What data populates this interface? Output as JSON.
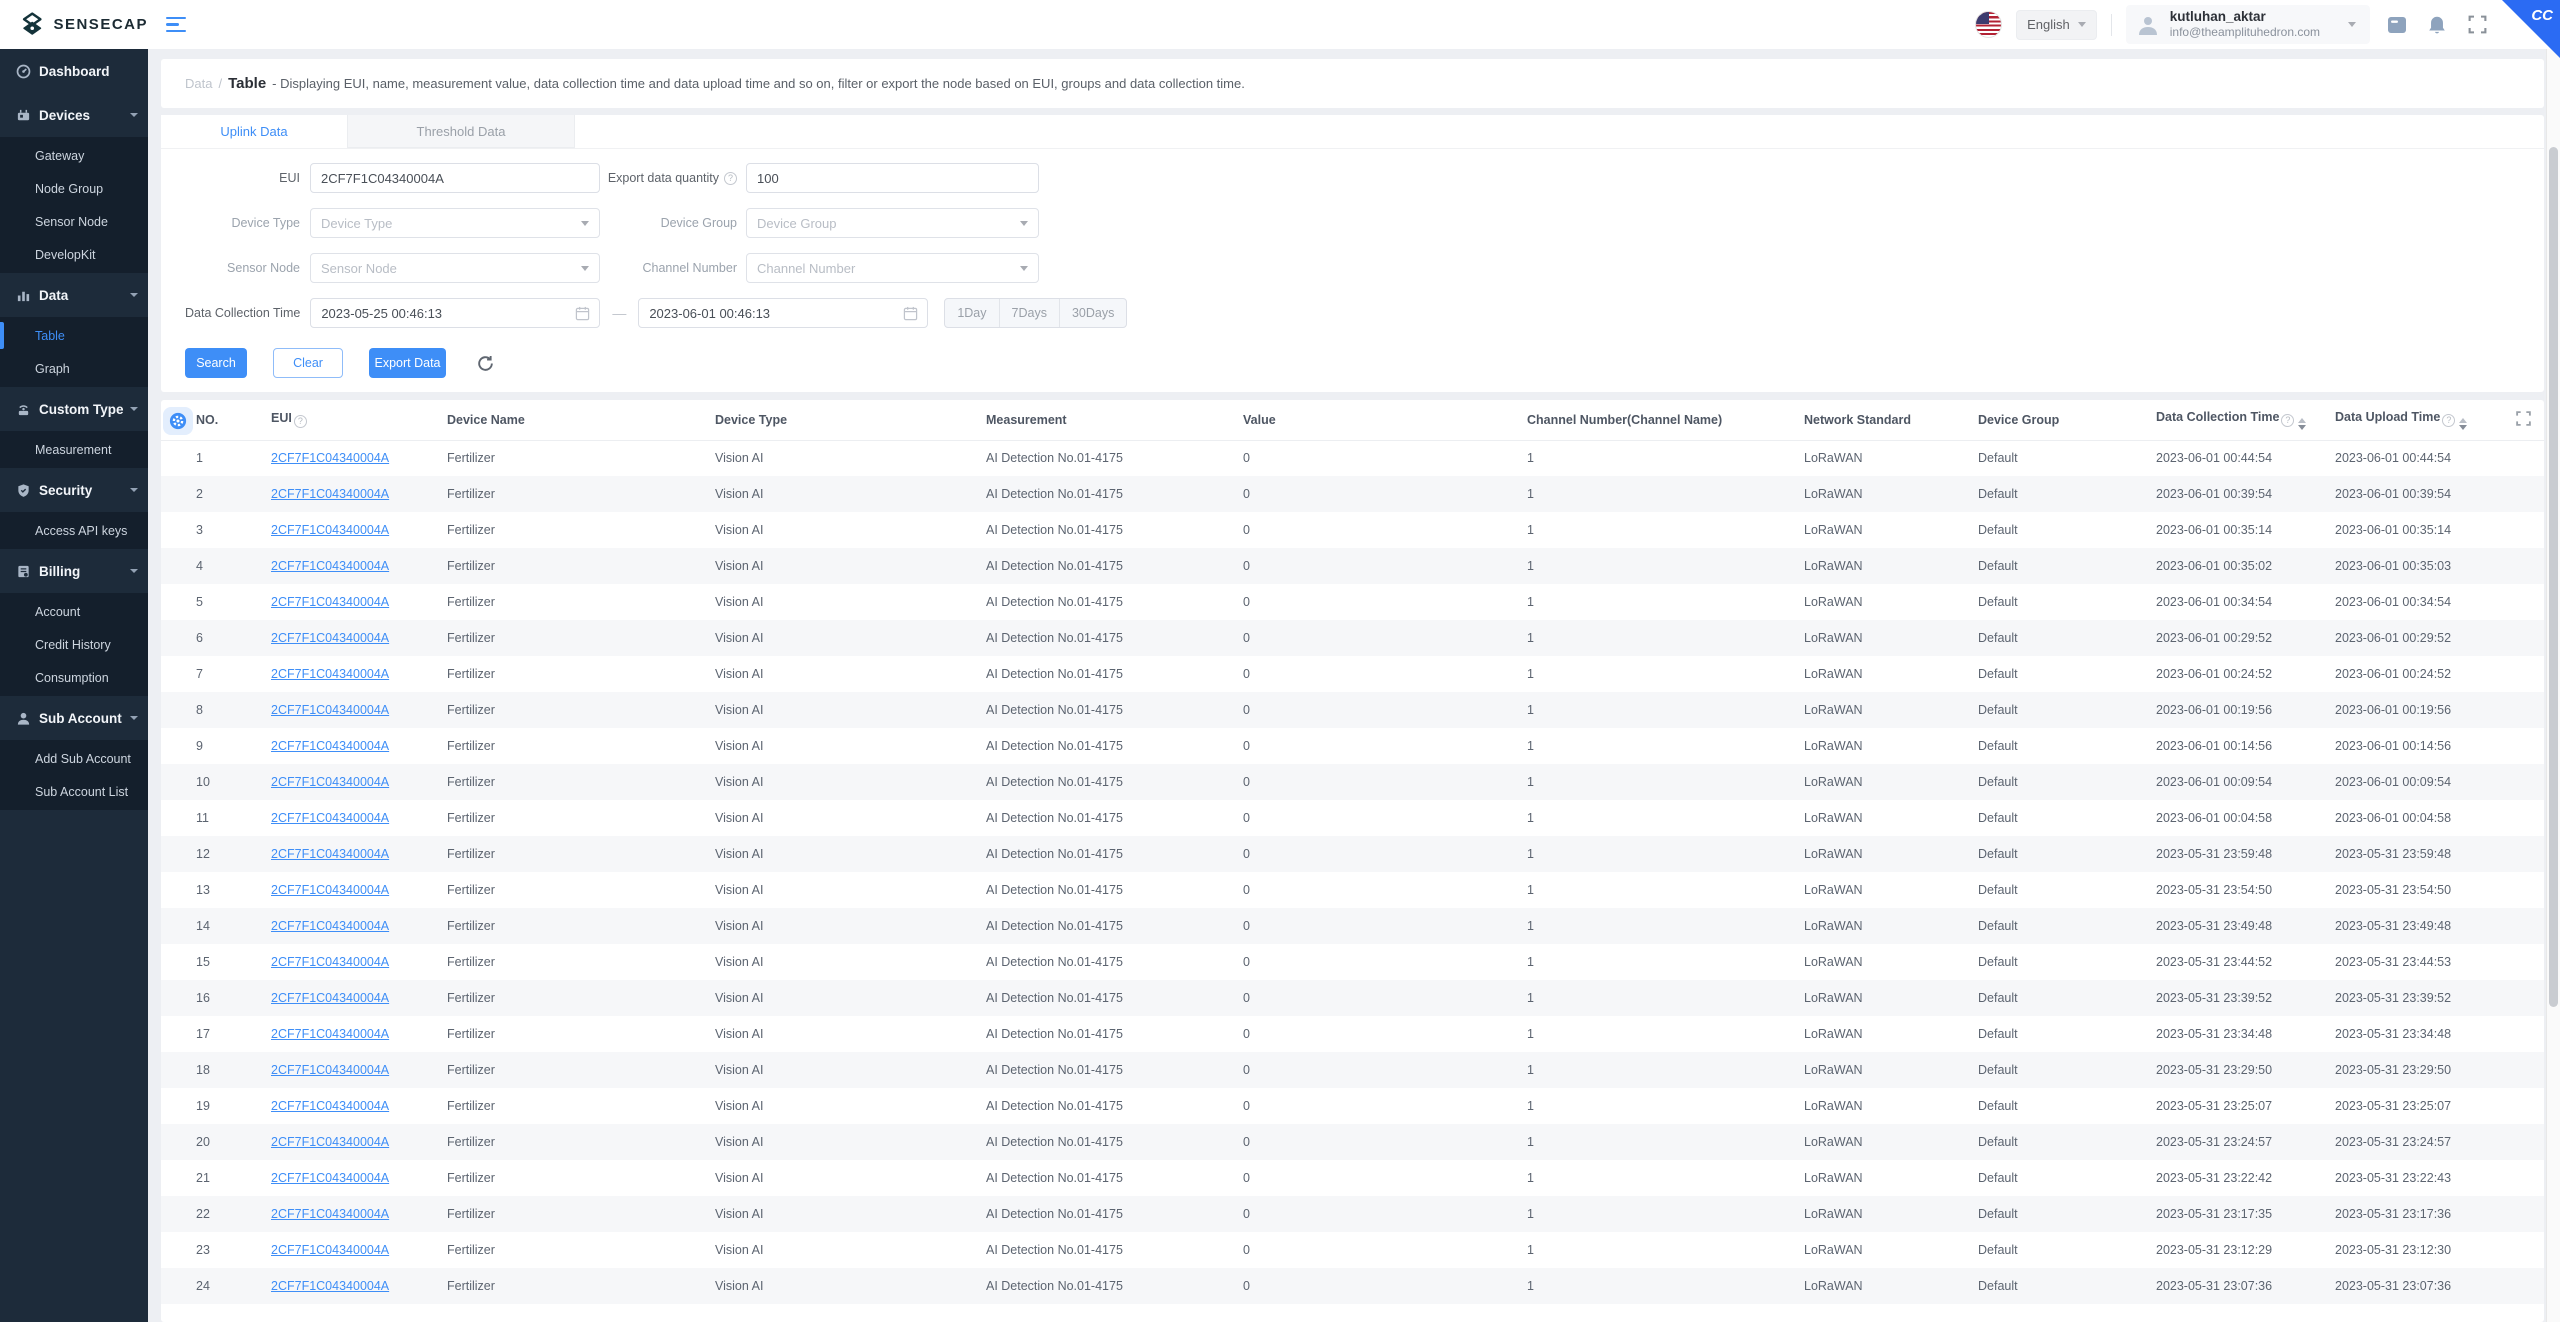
{
  "topbar": {
    "brand": "SENSECAP",
    "language": "English",
    "user_name": "kutluhan_aktar",
    "user_email": "info@theamplituhedron.com",
    "ribbon": "CC"
  },
  "sidebar": {
    "sections": [
      {
        "label": "Dashboard",
        "icon": "dashboard-icon",
        "expandable": false,
        "children": []
      },
      {
        "label": "Devices",
        "icon": "devices-icon",
        "expandable": true,
        "children": [
          {
            "label": "Gateway",
            "active": false
          },
          {
            "label": "Node Group",
            "active": false
          },
          {
            "label": "Sensor Node",
            "active": false
          },
          {
            "label": "DevelopKit",
            "active": false
          }
        ]
      },
      {
        "label": "Data",
        "icon": "data-icon",
        "expandable": true,
        "children": [
          {
            "label": "Table",
            "active": true
          },
          {
            "label": "Graph",
            "active": false
          }
        ]
      },
      {
        "label": "Custom Type",
        "icon": "custom-type-icon",
        "expandable": true,
        "children": [
          {
            "label": "Measurement",
            "active": false
          }
        ]
      },
      {
        "label": "Security",
        "icon": "security-icon",
        "expandable": true,
        "children": [
          {
            "label": "Access API keys",
            "active": false
          }
        ]
      },
      {
        "label": "Billing",
        "icon": "billing-icon",
        "expandable": true,
        "children": [
          {
            "label": "Account",
            "active": false
          },
          {
            "label": "Credit History",
            "active": false
          },
          {
            "label": "Consumption",
            "active": false
          }
        ]
      },
      {
        "label": "Sub Account",
        "icon": "sub-account-icon",
        "expandable": true,
        "children": [
          {
            "label": "Add Sub Account",
            "active": false
          },
          {
            "label": "Sub Account List",
            "active": false
          }
        ]
      }
    ]
  },
  "breadcrumb": {
    "section": "Data",
    "separator": "/",
    "page": "Table",
    "description": "- Displaying EUI, name, measurement value, data collection time and data upload time and so on, filter or export the node based on EUI, groups and data collection time."
  },
  "filter": {
    "tabs": {
      "uplink": "Uplink Data",
      "threshold": "Threshold Data"
    },
    "eui_label": "EUI",
    "eui_value": "2CF7F1C04340004A",
    "export_label": "Export data quantity",
    "export_value": "100",
    "device_type_label": "Device Type",
    "device_type_placeholder": "Device Type",
    "device_group_label": "Device Group",
    "device_group_placeholder": "Device Group",
    "sensor_node_label": "Sensor Node",
    "sensor_node_placeholder": "Sensor Node",
    "channel_number_label": "Channel Number",
    "channel_number_placeholder": "Channel Number",
    "date_label": "Data Collection Time",
    "date_from": "2023-05-25 00:46:13",
    "date_to": "2023-06-01 00:46:13",
    "quick_ranges": [
      "1Day",
      "7Days",
      "30Days"
    ],
    "search_label": "Search",
    "clear_label": "Clear",
    "export_btn_label": "Export Data"
  },
  "table": {
    "columns": [
      "NO.",
      "EUI",
      "Device Name",
      "Device Type",
      "Measurement",
      "Value",
      "Channel Number(Channel Name)",
      "Network Standard",
      "Device Group",
      "Data Collection Time",
      "Data Upload Time"
    ],
    "rows": [
      {
        "no": "1",
        "eui": "2CF7F1C04340004A",
        "device_name": "Fertilizer",
        "device_type": "Vision AI",
        "measurement": "AI Detection No.01-4175",
        "value": "0",
        "channel": "1",
        "network_standard": "LoRaWAN",
        "device_group": "Default",
        "collection_time": "2023-06-01 00:44:54",
        "upload_time": "2023-06-01 00:44:54"
      },
      {
        "no": "2",
        "eui": "2CF7F1C04340004A",
        "device_name": "Fertilizer",
        "device_type": "Vision AI",
        "measurement": "AI Detection No.01-4175",
        "value": "0",
        "channel": "1",
        "network_standard": "LoRaWAN",
        "device_group": "Default",
        "collection_time": "2023-06-01 00:39:54",
        "upload_time": "2023-06-01 00:39:54"
      },
      {
        "no": "3",
        "eui": "2CF7F1C04340004A",
        "device_name": "Fertilizer",
        "device_type": "Vision AI",
        "measurement": "AI Detection No.01-4175",
        "value": "0",
        "channel": "1",
        "network_standard": "LoRaWAN",
        "device_group": "Default",
        "collection_time": "2023-06-01 00:35:14",
        "upload_time": "2023-06-01 00:35:14"
      },
      {
        "no": "4",
        "eui": "2CF7F1C04340004A",
        "device_name": "Fertilizer",
        "device_type": "Vision AI",
        "measurement": "AI Detection No.01-4175",
        "value": "0",
        "channel": "1",
        "network_standard": "LoRaWAN",
        "device_group": "Default",
        "collection_time": "2023-06-01 00:35:02",
        "upload_time": "2023-06-01 00:35:03"
      },
      {
        "no": "5",
        "eui": "2CF7F1C04340004A",
        "device_name": "Fertilizer",
        "device_type": "Vision AI",
        "measurement": "AI Detection No.01-4175",
        "value": "0",
        "channel": "1",
        "network_standard": "LoRaWAN",
        "device_group": "Default",
        "collection_time": "2023-06-01 00:34:54",
        "upload_time": "2023-06-01 00:34:54"
      },
      {
        "no": "6",
        "eui": "2CF7F1C04340004A",
        "device_name": "Fertilizer",
        "device_type": "Vision AI",
        "measurement": "AI Detection No.01-4175",
        "value": "0",
        "channel": "1",
        "network_standard": "LoRaWAN",
        "device_group": "Default",
        "collection_time": "2023-06-01 00:29:52",
        "upload_time": "2023-06-01 00:29:52"
      },
      {
        "no": "7",
        "eui": "2CF7F1C04340004A",
        "device_name": "Fertilizer",
        "device_type": "Vision AI",
        "measurement": "AI Detection No.01-4175",
        "value": "0",
        "channel": "1",
        "network_standard": "LoRaWAN",
        "device_group": "Default",
        "collection_time": "2023-06-01 00:24:52",
        "upload_time": "2023-06-01 00:24:52"
      },
      {
        "no": "8",
        "eui": "2CF7F1C04340004A",
        "device_name": "Fertilizer",
        "device_type": "Vision AI",
        "measurement": "AI Detection No.01-4175",
        "value": "0",
        "channel": "1",
        "network_standard": "LoRaWAN",
        "device_group": "Default",
        "collection_time": "2023-06-01 00:19:56",
        "upload_time": "2023-06-01 00:19:56"
      },
      {
        "no": "9",
        "eui": "2CF7F1C04340004A",
        "device_name": "Fertilizer",
        "device_type": "Vision AI",
        "measurement": "AI Detection No.01-4175",
        "value": "0",
        "channel": "1",
        "network_standard": "LoRaWAN",
        "device_group": "Default",
        "collection_time": "2023-06-01 00:14:56",
        "upload_time": "2023-06-01 00:14:56"
      },
      {
        "no": "10",
        "eui": "2CF7F1C04340004A",
        "device_name": "Fertilizer",
        "device_type": "Vision AI",
        "measurement": "AI Detection No.01-4175",
        "value": "0",
        "channel": "1",
        "network_standard": "LoRaWAN",
        "device_group": "Default",
        "collection_time": "2023-06-01 00:09:54",
        "upload_time": "2023-06-01 00:09:54"
      },
      {
        "no": "11",
        "eui": "2CF7F1C04340004A",
        "device_name": "Fertilizer",
        "device_type": "Vision AI",
        "measurement": "AI Detection No.01-4175",
        "value": "0",
        "channel": "1",
        "network_standard": "LoRaWAN",
        "device_group": "Default",
        "collection_time": "2023-06-01 00:04:58",
        "upload_time": "2023-06-01 00:04:58"
      },
      {
        "no": "12",
        "eui": "2CF7F1C04340004A",
        "device_name": "Fertilizer",
        "device_type": "Vision AI",
        "measurement": "AI Detection No.01-4175",
        "value": "0",
        "channel": "1",
        "network_standard": "LoRaWAN",
        "device_group": "Default",
        "collection_time": "2023-05-31 23:59:48",
        "upload_time": "2023-05-31 23:59:48"
      },
      {
        "no": "13",
        "eui": "2CF7F1C04340004A",
        "device_name": "Fertilizer",
        "device_type": "Vision AI",
        "measurement": "AI Detection No.01-4175",
        "value": "0",
        "channel": "1",
        "network_standard": "LoRaWAN",
        "device_group": "Default",
        "collection_time": "2023-05-31 23:54:50",
        "upload_time": "2023-05-31 23:54:50"
      },
      {
        "no": "14",
        "eui": "2CF7F1C04340004A",
        "device_name": "Fertilizer",
        "device_type": "Vision AI",
        "measurement": "AI Detection No.01-4175",
        "value": "0",
        "channel": "1",
        "network_standard": "LoRaWAN",
        "device_group": "Default",
        "collection_time": "2023-05-31 23:49:48",
        "upload_time": "2023-05-31 23:49:48"
      },
      {
        "no": "15",
        "eui": "2CF7F1C04340004A",
        "device_name": "Fertilizer",
        "device_type": "Vision AI",
        "measurement": "AI Detection No.01-4175",
        "value": "0",
        "channel": "1",
        "network_standard": "LoRaWAN",
        "device_group": "Default",
        "collection_time": "2023-05-31 23:44:52",
        "upload_time": "2023-05-31 23:44:53"
      },
      {
        "no": "16",
        "eui": "2CF7F1C04340004A",
        "device_name": "Fertilizer",
        "device_type": "Vision AI",
        "measurement": "AI Detection No.01-4175",
        "value": "0",
        "channel": "1",
        "network_standard": "LoRaWAN",
        "device_group": "Default",
        "collection_time": "2023-05-31 23:39:52",
        "upload_time": "2023-05-31 23:39:52"
      },
      {
        "no": "17",
        "eui": "2CF7F1C04340004A",
        "device_name": "Fertilizer",
        "device_type": "Vision AI",
        "measurement": "AI Detection No.01-4175",
        "value": "0",
        "channel": "1",
        "network_standard": "LoRaWAN",
        "device_group": "Default",
        "collection_time": "2023-05-31 23:34:48",
        "upload_time": "2023-05-31 23:34:48"
      },
      {
        "no": "18",
        "eui": "2CF7F1C04340004A",
        "device_name": "Fertilizer",
        "device_type": "Vision AI",
        "measurement": "AI Detection No.01-4175",
        "value": "0",
        "channel": "1",
        "network_standard": "LoRaWAN",
        "device_group": "Default",
        "collection_time": "2023-05-31 23:29:50",
        "upload_time": "2023-05-31 23:29:50"
      },
      {
        "no": "19",
        "eui": "2CF7F1C04340004A",
        "device_name": "Fertilizer",
        "device_type": "Vision AI",
        "measurement": "AI Detection No.01-4175",
        "value": "0",
        "channel": "1",
        "network_standard": "LoRaWAN",
        "device_group": "Default",
        "collection_time": "2023-05-31 23:25:07",
        "upload_time": "2023-05-31 23:25:07"
      },
      {
        "no": "20",
        "eui": "2CF7F1C04340004A",
        "device_name": "Fertilizer",
        "device_type": "Vision AI",
        "measurement": "AI Detection No.01-4175",
        "value": "0",
        "channel": "1",
        "network_standard": "LoRaWAN",
        "device_group": "Default",
        "collection_time": "2023-05-31 23:24:57",
        "upload_time": "2023-05-31 23:24:57"
      },
      {
        "no": "21",
        "eui": "2CF7F1C04340004A",
        "device_name": "Fertilizer",
        "device_type": "Vision AI",
        "measurement": "AI Detection No.01-4175",
        "value": "0",
        "channel": "1",
        "network_standard": "LoRaWAN",
        "device_group": "Default",
        "collection_time": "2023-05-31 23:22:42",
        "upload_time": "2023-05-31 23:22:43"
      },
      {
        "no": "22",
        "eui": "2CF7F1C04340004A",
        "device_name": "Fertilizer",
        "device_type": "Vision AI",
        "measurement": "AI Detection No.01-4175",
        "value": "0",
        "channel": "1",
        "network_standard": "LoRaWAN",
        "device_group": "Default",
        "collection_time": "2023-05-31 23:17:35",
        "upload_time": "2023-05-31 23:17:36"
      },
      {
        "no": "23",
        "eui": "2CF7F1C04340004A",
        "device_name": "Fertilizer",
        "device_type": "Vision AI",
        "measurement": "AI Detection No.01-4175",
        "value": "0",
        "channel": "1",
        "network_standard": "LoRaWAN",
        "device_group": "Default",
        "collection_time": "2023-05-31 23:12:29",
        "upload_time": "2023-05-31 23:12:30"
      },
      {
        "no": "24",
        "eui": "2CF7F1C04340004A",
        "device_name": "Fertilizer",
        "device_type": "Vision AI",
        "measurement": "AI Detection No.01-4175",
        "value": "0",
        "channel": "1",
        "network_standard": "LoRaWAN",
        "device_group": "Default",
        "collection_time": "2023-05-31 23:07:36",
        "upload_time": "2023-05-31 23:07:36"
      }
    ]
  },
  "colors": {
    "accent": "#3e8ef7",
    "sidebar_bg": "#1d2b3a",
    "sidebar_sub_bg": "#141f2c",
    "ribbon": "#2b6bf3"
  }
}
